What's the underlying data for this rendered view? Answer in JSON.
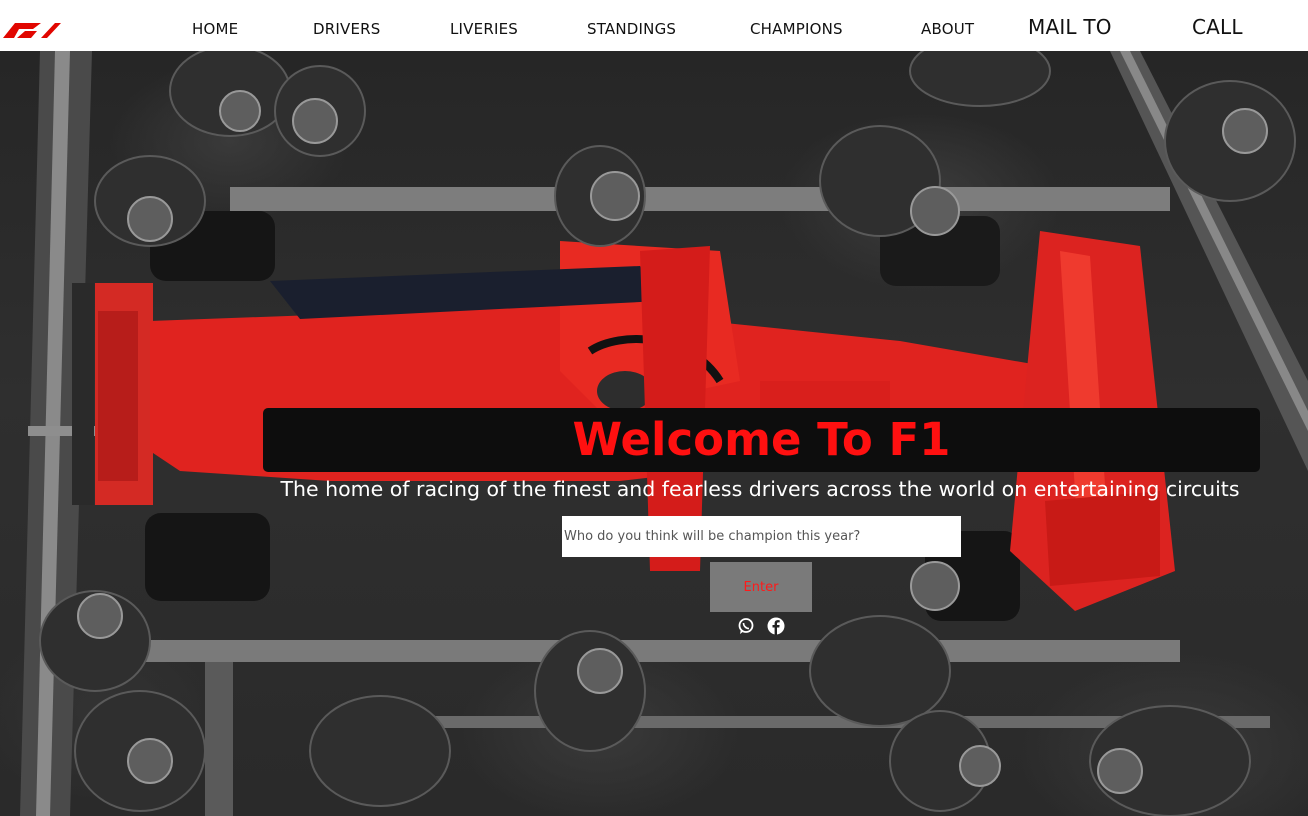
{
  "brand": {
    "logo_alt": "F1",
    "accent_color": "#e10600"
  },
  "nav": {
    "items": [
      "HOME",
      "DRIVERS",
      "LIVERIES",
      "STANDINGS",
      "CHAMPIONS",
      "ABOUT"
    ],
    "mail": "MAIL TO",
    "call": "CALL"
  },
  "hero": {
    "background": "aerial photo of Ferrari F1 pit stop, red car on grayscale background",
    "title": "Welcome To F1",
    "subtitle": "The home of racing of the finest and fearless drivers across the world on entertaining circuits",
    "input_placeholder": "Who do you think will be champion this year?",
    "input_value": "",
    "button_label": "Enter",
    "social": [
      "whatsapp-icon",
      "facebook-icon"
    ]
  }
}
